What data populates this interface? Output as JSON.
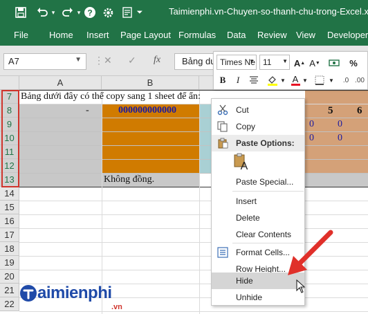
{
  "window": {
    "title": "Taimienphi.vn-Chuyen-so-thanh-chu-trong-Excel.xls"
  },
  "ribbon": {
    "tabs": [
      {
        "label": "File"
      },
      {
        "label": "Home"
      },
      {
        "label": "Insert"
      },
      {
        "label": "Page Layout"
      },
      {
        "label": "Formulas"
      },
      {
        "label": "Data"
      },
      {
        "label": "Review"
      },
      {
        "label": "View"
      },
      {
        "label": "Developer"
      }
    ]
  },
  "formula_bar": {
    "name_box": "A7",
    "fx": "fx",
    "content": "Bảng dư"
  },
  "sheet": {
    "columns": [
      "A",
      "B"
    ],
    "rows": [
      "7",
      "8",
      "9",
      "10",
      "11",
      "12",
      "13",
      "14",
      "15",
      "16",
      "17",
      "18",
      "19",
      "20",
      "21",
      "22"
    ],
    "cells": {
      "a7": "Bảng dưới đây có thể copy sang 1 sheet để ẩn:",
      "a8": "-",
      "b8": "000000000000",
      "b13": "Không đồng.",
      "g7_5": "5",
      "g7_6": "6",
      "r9a": "0",
      "r9b": "0",
      "r10a": "0",
      "r10b": "0"
    },
    "colors": {
      "orange": "#d07b00",
      "teal": "#a9d0d4",
      "tan": "#d4a178",
      "grey": "#c8c8c8",
      "blue": "#1a1aa0"
    }
  },
  "mini_toolbar": {
    "font": "Times Ne",
    "size": "11",
    "bold": "B",
    "italic": "I",
    "font_color_letter": "A"
  },
  "context_menu": {
    "cut": "Cut",
    "copy": "Copy",
    "paste_options": "Paste Options:",
    "paste_special": "Paste Special...",
    "insert": "Insert",
    "delete": "Delete",
    "clear_contents": "Clear Contents",
    "format_cells": "Format Cells...",
    "row_height": "Row Height...",
    "hide": "Hide",
    "unhide": "Unhide"
  },
  "logo": {
    "text": "aimienphi",
    "suffix": ".vn"
  },
  "accent": {
    "excel_green": "#217346",
    "red": "#d0342c"
  }
}
